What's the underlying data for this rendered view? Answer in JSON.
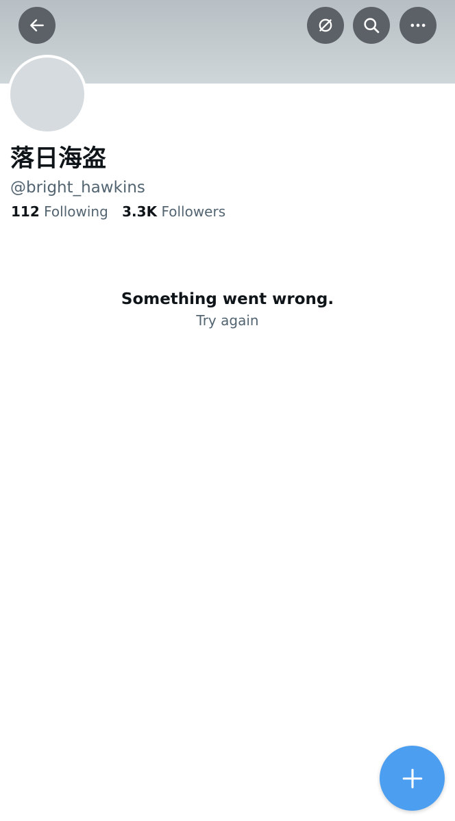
{
  "profile": {
    "display_name": "落日海盗",
    "handle": "@bright_hawkins",
    "following_count": "112",
    "following_label": "Following",
    "followers_count": "3.3K",
    "followers_label": "Followers"
  },
  "header": {
    "back_icon": "arrow-left-icon",
    "hide_icon": "eye-slash-icon",
    "search_icon": "search-icon",
    "more_icon": "more-horizontal-icon"
  },
  "error": {
    "title": "Something went wrong.",
    "retry_label": "Try again"
  },
  "fab": {
    "icon": "plus-icon"
  },
  "colors": {
    "accent": "#4c9ef0",
    "text_primary": "#0f1419",
    "text_secondary": "#536471",
    "banner": "#c8cfd3",
    "header_button": "#5b6166"
  }
}
